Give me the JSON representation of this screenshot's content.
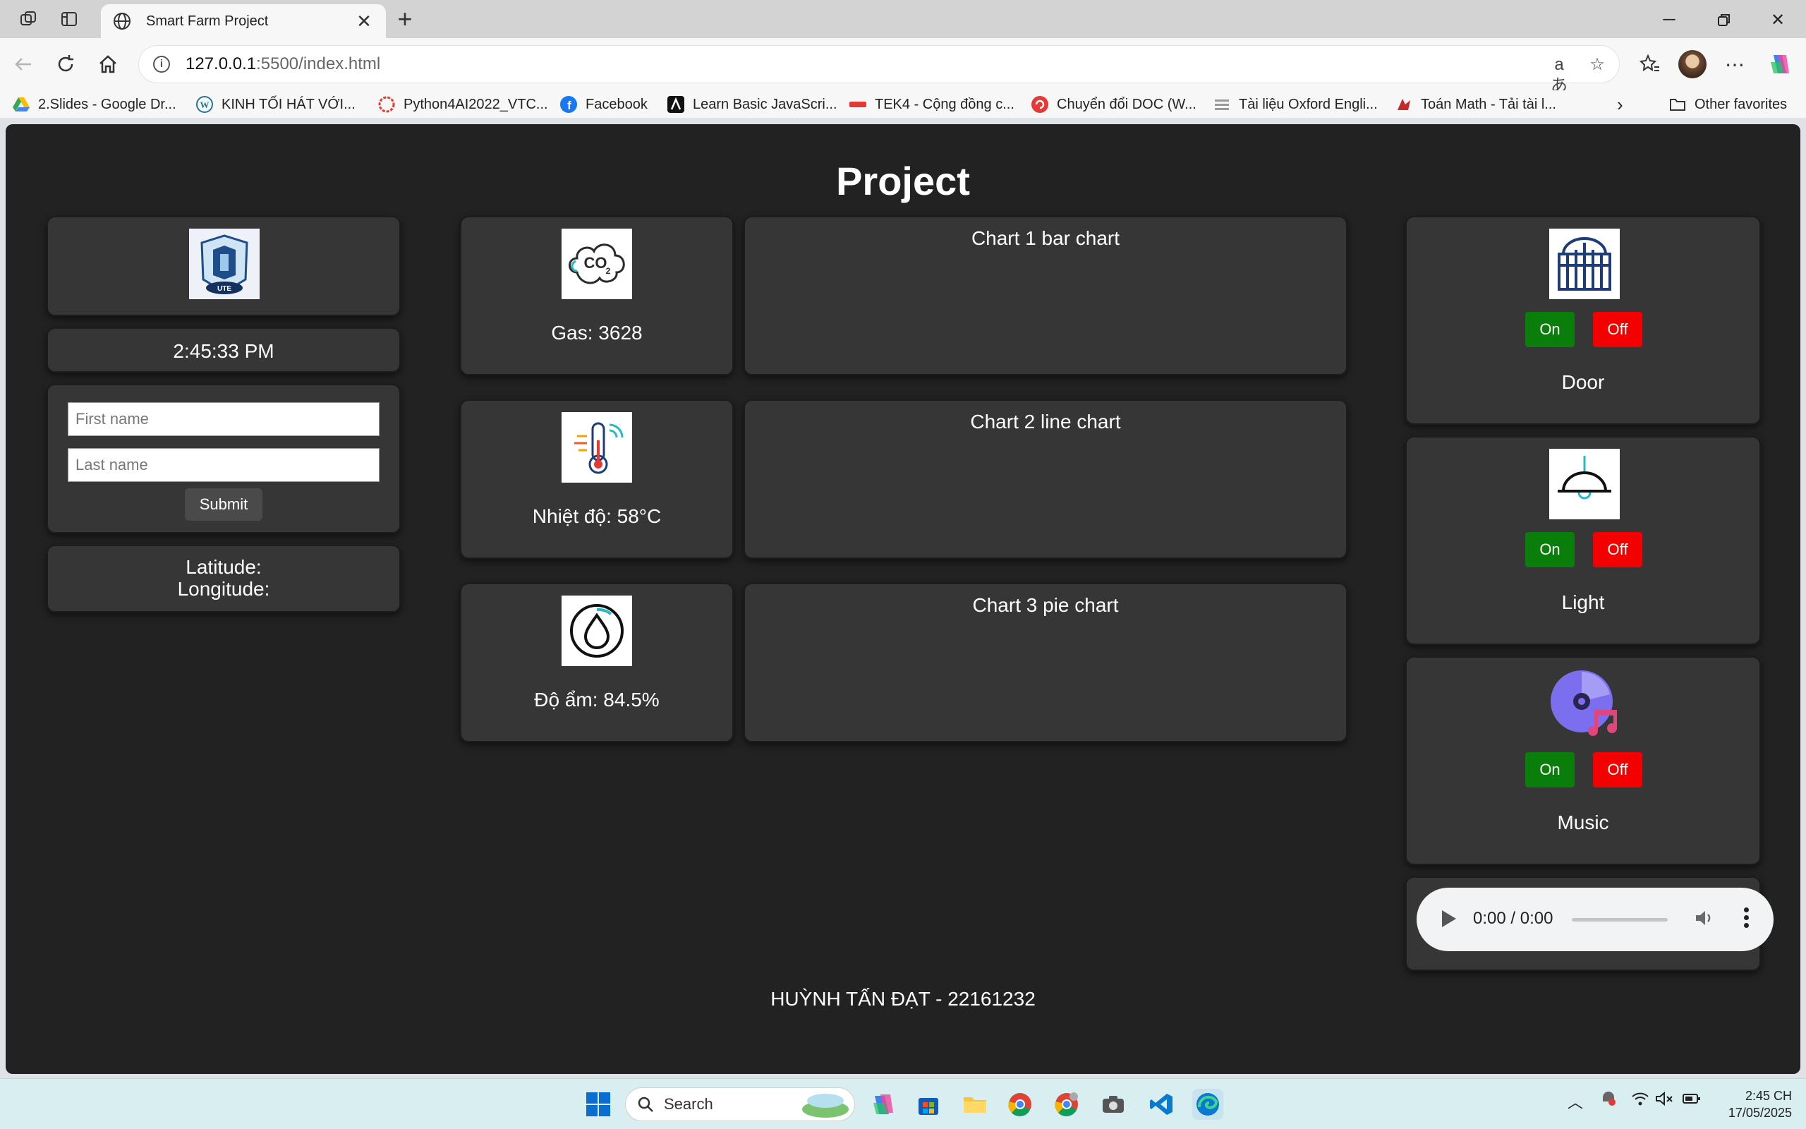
{
  "browser": {
    "tab_title": "Smart Farm Project",
    "url_host": "127.0.0.1",
    "url_path": ":5500/index.html",
    "favorites": [
      {
        "label": "2.Slides - Google Dr...",
        "icon": "google-drive-icon"
      },
      {
        "label": "KINH TỐI HÁT VỚI...",
        "icon": "wordpress-icon"
      },
      {
        "label": "Python4AI2022_VTC...",
        "icon": "python4ai-icon"
      },
      {
        "label": "Facebook",
        "icon": "facebook-icon"
      },
      {
        "label": "Learn Basic JavaScri...",
        "icon": "learn-js-icon"
      },
      {
        "label": "TEK4 - Cộng đồng c...",
        "icon": "tek4-icon"
      },
      {
        "label": "Chuyển đổi DOC (W...",
        "icon": "doc-convert-icon"
      },
      {
        "label": "Tài liệu Oxford Engli...",
        "icon": "oxford-icon"
      },
      {
        "label": "Toán Math - Tải tài l...",
        "icon": "toan-math-icon"
      }
    ],
    "other_favorites": "Other favorites"
  },
  "page": {
    "title": "Project",
    "clock": "2:45:33 PM",
    "form": {
      "first_placeholder": "First name",
      "last_placeholder": "Last name",
      "submit_label": "Submit"
    },
    "location": {
      "latitude_label": "Latitude:",
      "longitude_label": "Longitude:"
    },
    "sensors": [
      {
        "label": "Gas: 3628",
        "icon": "co2-icon"
      },
      {
        "label": "Nhiệt độ: 58°C",
        "icon": "thermometer-icon"
      },
      {
        "label": "Độ ẩm: 84.5%",
        "icon": "humidity-drop-icon"
      }
    ],
    "charts": [
      {
        "title": "Chart 1 bar chart"
      },
      {
        "title": "Chart 2 line chart"
      },
      {
        "title": "Chart 3 pie chart"
      }
    ],
    "devices": [
      {
        "name": "Door",
        "icon": "door-gate-icon",
        "on_label": "On",
        "off_label": "Off"
      },
      {
        "name": "Light",
        "icon": "lamp-icon",
        "on_label": "On",
        "off_label": "Off"
      },
      {
        "name": "Music",
        "icon": "music-disc-icon",
        "on_label": "On",
        "off_label": "Off"
      }
    ],
    "audio": {
      "time": "0:00 / 0:00"
    },
    "footer": "HUỲNH TẤN ĐẠT - 22161232"
  },
  "taskbar": {
    "search_label": "Search",
    "time": "2:45 CH",
    "date": "17/05/2025"
  },
  "colors": {
    "page_bg": "#222222",
    "card_bg": "#363636",
    "on_button": "#0a7e0a",
    "off_button": "#f50000"
  }
}
